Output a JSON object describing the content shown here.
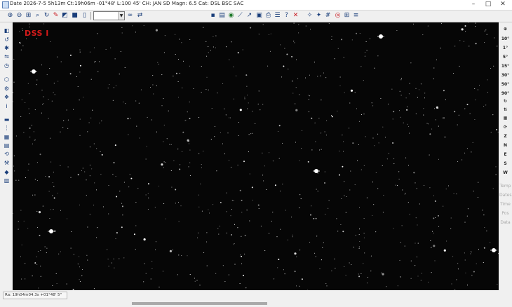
{
  "window": {
    "title": "Date 2026-7-5  5h13m Ct:19h06m  -01°48' L:100 45' CH: JAN SD Magn: 6.5 Cat: DSL BSC SAC",
    "controls": {
      "minimize": "–",
      "maximize": "□",
      "close": "✕"
    }
  },
  "toolbar": {
    "zoom_combo_value": "",
    "icons": [
      "zoom-in-icon",
      "zoom-out-icon",
      "zoom-fit-icon",
      "search-icon",
      "sync-icon",
      "pen-icon",
      "color-invert-icon",
      "dual-color-icon",
      "document-icon",
      "binoculars-icon",
      "save-icon",
      "calendar-icon",
      "globe-icon",
      "telescope-icon",
      "pointer-icon",
      "camera-icon",
      "print-icon",
      "list-icon",
      "help-icon",
      "close-icon",
      "constellation-icon",
      "star-chart-icon",
      "target-icon",
      "grid-icon"
    ]
  },
  "left_toolbar": {
    "icons": [
      "mode-icon",
      "rotate-icon",
      "star-icon",
      "mirror-icon",
      "clock-icon",
      "shield-icon",
      "settings-icon",
      "palette-icon",
      "cube-icon",
      "info-icon",
      "block-icon",
      "layers-icon",
      "flip-icon",
      "cursor-icon",
      "refresh-icon",
      "tools-icon",
      "filter-icon"
    ]
  },
  "right_toolbar": {
    "fov_items": [
      "10°",
      "1°",
      "5°",
      "15°",
      "30°",
      "50°",
      "90°"
    ],
    "nav_items": [
      "Z",
      "N",
      "E",
      "S",
      "W"
    ],
    "disabled_items": [
      "Temp",
      "Dates",
      "Time",
      "Pos",
      "Data"
    ]
  },
  "sky_view": {
    "survey_label": "DSS I",
    "background": "#060606",
    "survey_label_color": "#d51a1a"
  },
  "status": {
    "cursor_coords": "Ra: 19h04m04.3s  +01°48' 5\""
  },
  "colors": {
    "toolbar_icon": "#1a3e7a",
    "accent_red": "#c8161d"
  }
}
